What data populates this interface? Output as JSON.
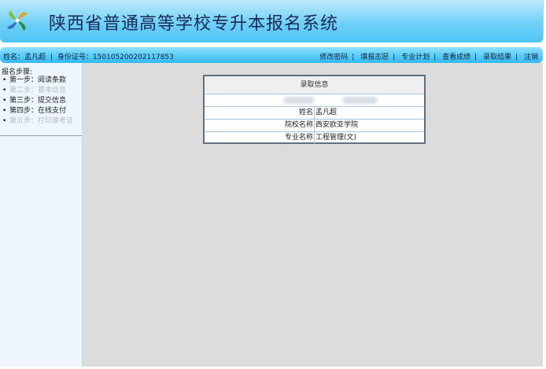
{
  "header": {
    "title": "陕西省普通高等学校专升本报名系统",
    "logo": "pinwheel-logo"
  },
  "infobar": {
    "name_label": "姓名：孟凡超",
    "id_label": "身份证号：150105200202117853",
    "nav": [
      "修改密码",
      "填报志愿",
      "专业计划",
      "查看成绩",
      "录取结果",
      "注销"
    ]
  },
  "sidebar": {
    "title": "报名步骤:",
    "steps": [
      {
        "label": "第一步：阅读条款",
        "enabled": true
      },
      {
        "label": "第二步：基本信息",
        "enabled": false
      },
      {
        "label": "第三步：提交信息",
        "enabled": true
      },
      {
        "label": "第四步：在线支付",
        "enabled": true
      },
      {
        "label": "第五步：打印准考证",
        "enabled": false
      }
    ]
  },
  "admission": {
    "header": "录取信息",
    "rows": [
      {
        "label": "姓名",
        "value": "孟凡超"
      },
      {
        "label": "院校名称",
        "value": "西安欧亚学院"
      },
      {
        "label": "专业名称",
        "value": "工程管理(文)"
      }
    ]
  },
  "colors": {
    "header_top": "#bfeaff",
    "header_bottom": "#4fc4f4",
    "bar": "#31b9f2",
    "main_bg": "#dcdcdc"
  }
}
